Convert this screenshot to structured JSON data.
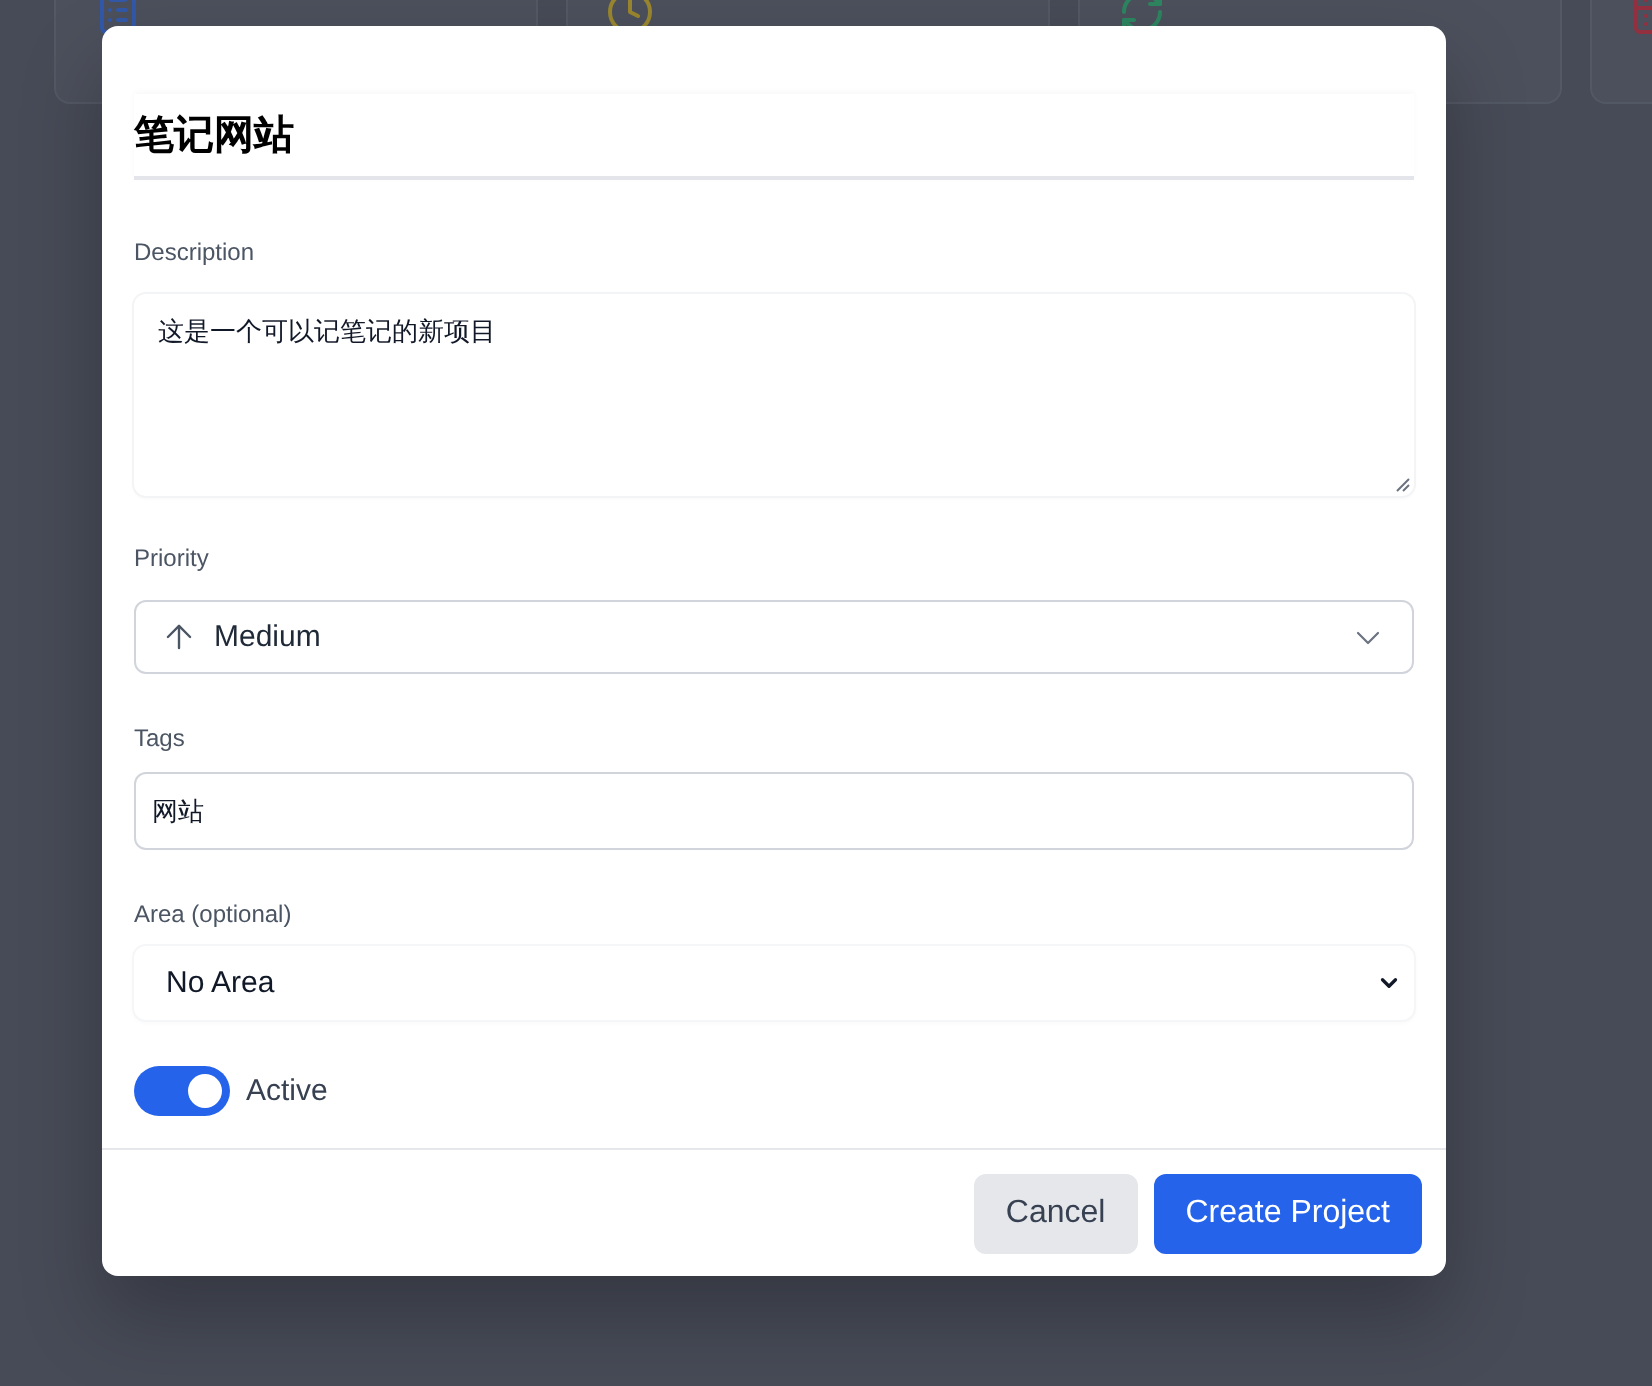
{
  "dialog": {
    "title_field": {
      "value": "笔记网站"
    },
    "fields": [
      {
        "kind": "textarea",
        "label": "Description",
        "value": "这是一个可以记笔记的新项目"
      },
      {
        "kind": "priority_select",
        "label": "Priority",
        "value": "Medium"
      },
      {
        "kind": "text",
        "label": "Tags",
        "value": "网站"
      },
      {
        "kind": "select",
        "label": "Area (optional)",
        "value": "No Area"
      }
    ],
    "toggle": {
      "label": "Active",
      "on": true
    },
    "buttons": [
      {
        "kind": "secondary",
        "label": "Cancel"
      },
      {
        "kind": "primary",
        "label": "Create Project"
      }
    ]
  }
}
